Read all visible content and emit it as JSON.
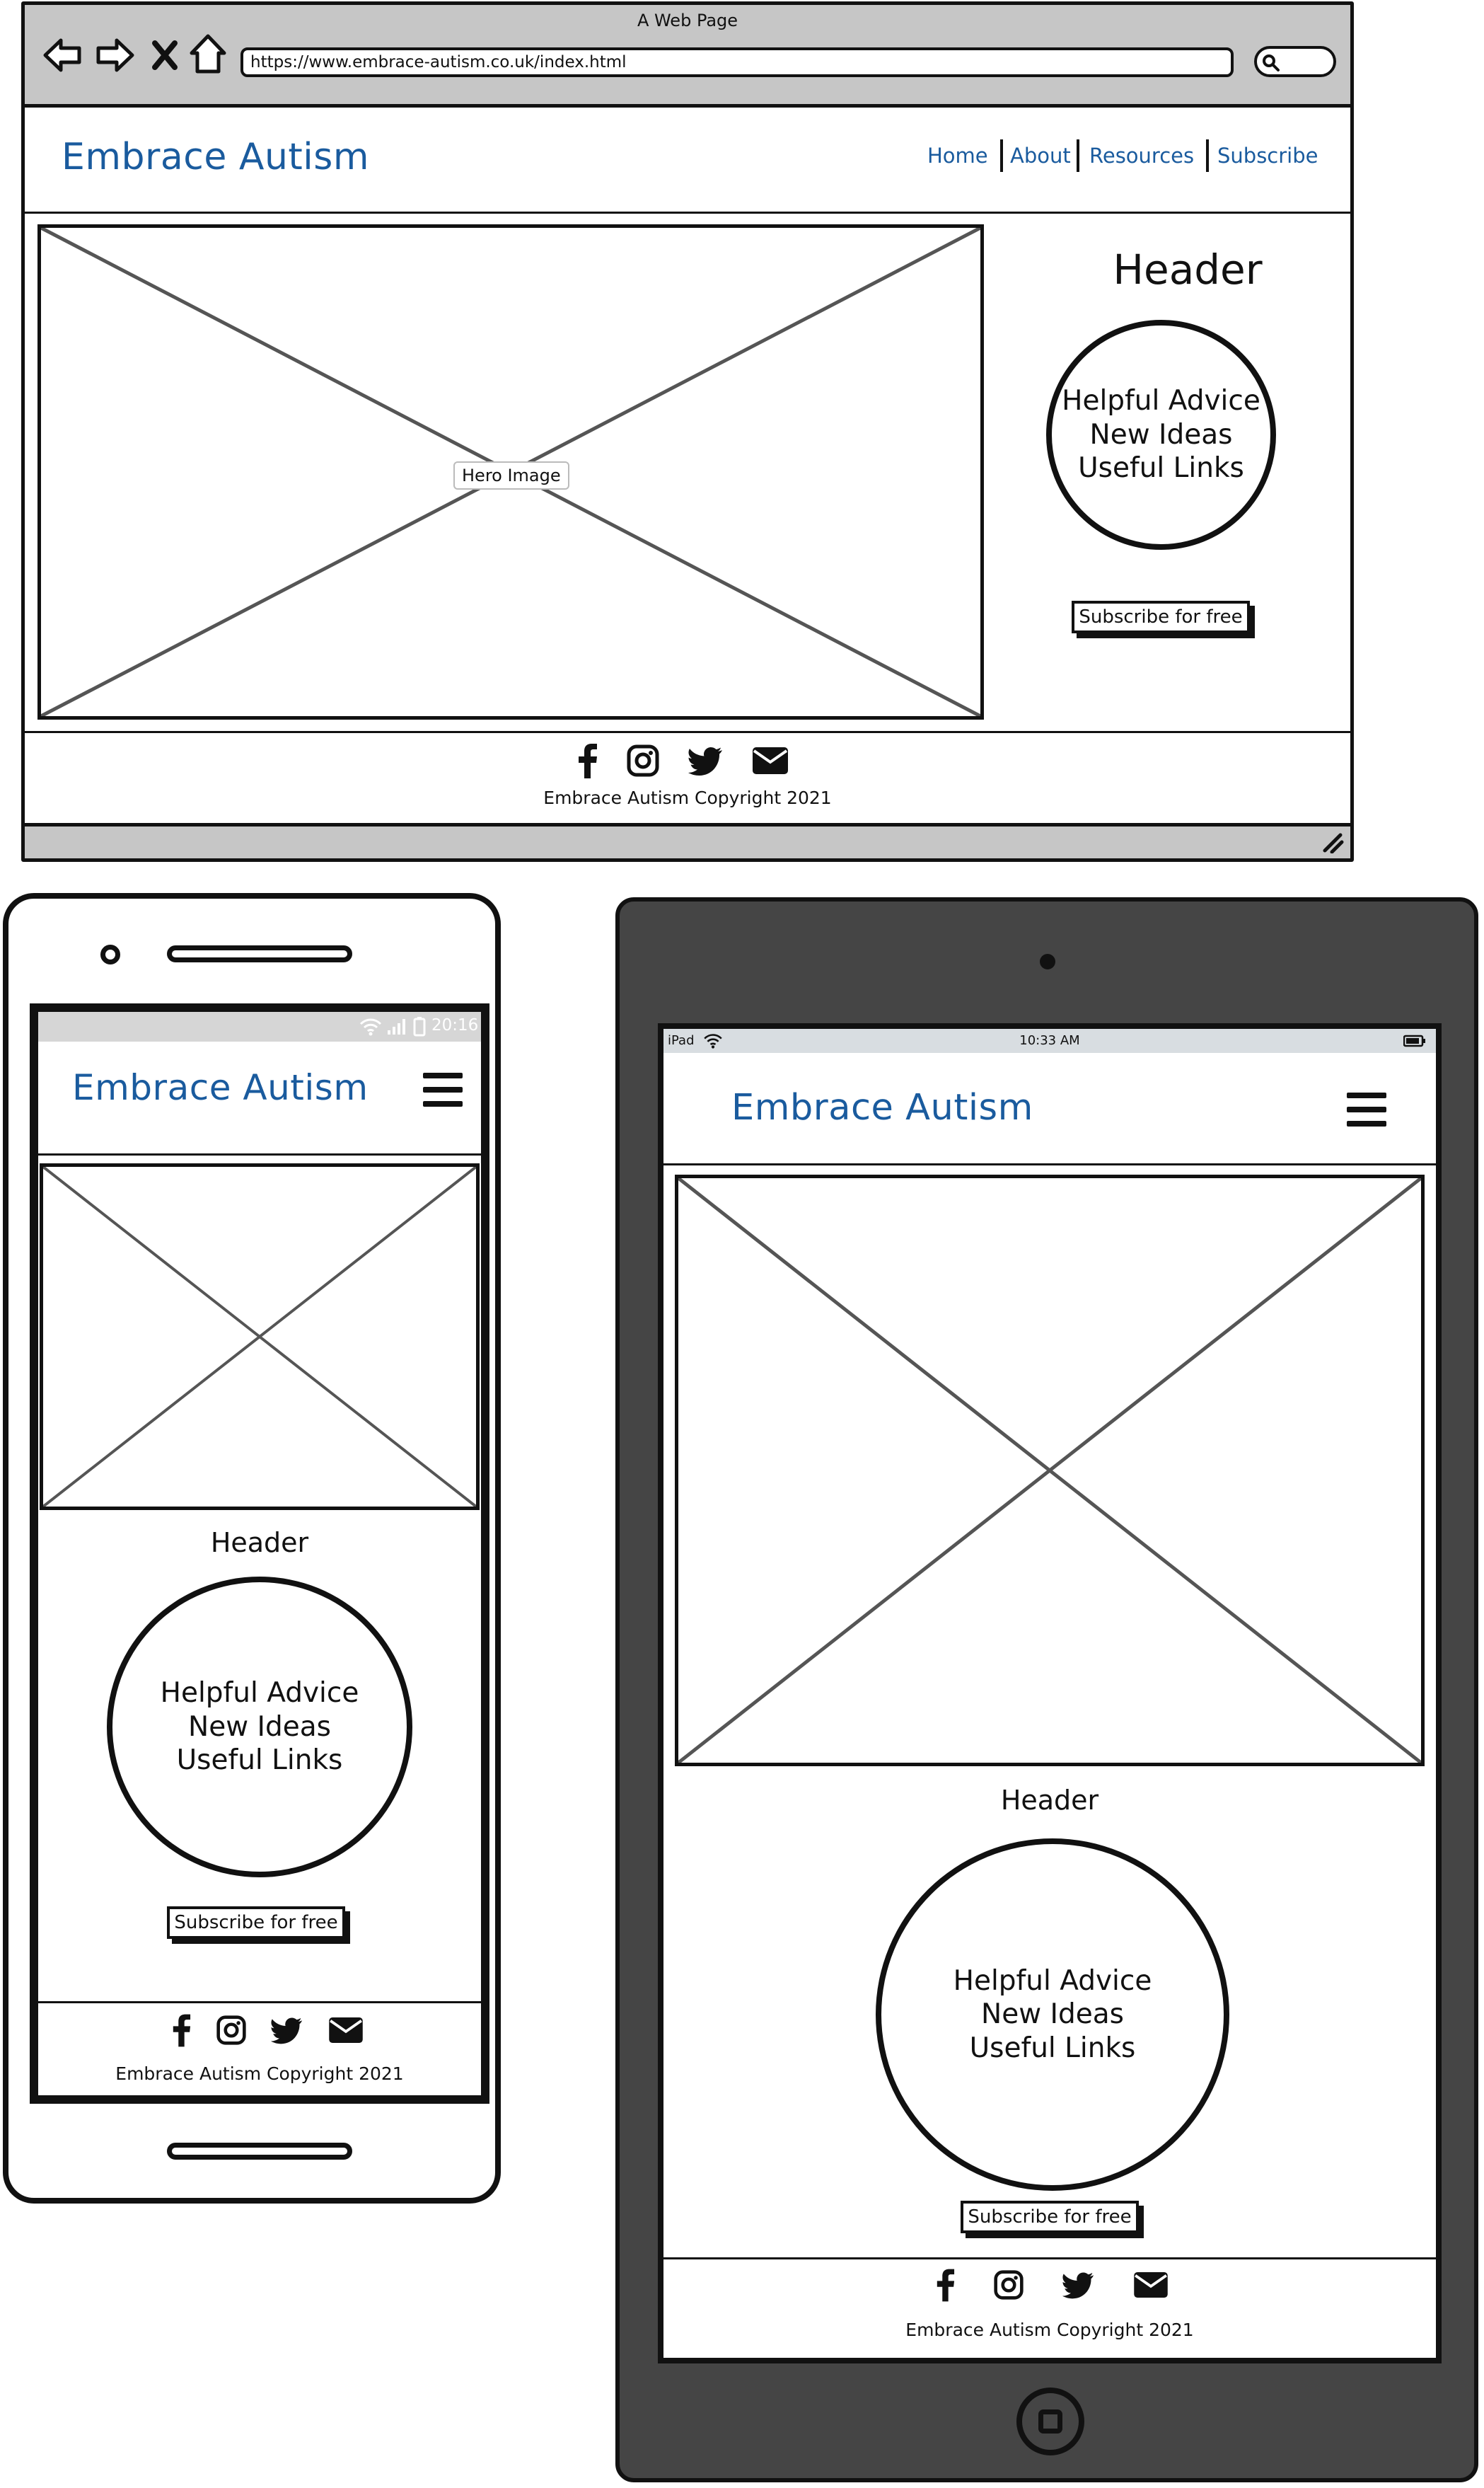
{
  "browser": {
    "window_title": "A Web Page",
    "url": "https://www.embrace-autism.co.uk/index.html",
    "site_title": "Embrace Autism",
    "nav": [
      "Home",
      "About",
      "Resources",
      "Subscribe"
    ],
    "hero_label": "Hero Image",
    "header": "Header",
    "circle_lines": [
      "Helpful Advice",
      "New Ideas",
      "Useful Links"
    ],
    "subscribe_label": "Subscribe for free",
    "copyright": "Embrace Autism Copyright 2021"
  },
  "phone": {
    "status_time": "20:16",
    "site_title": "Embrace Autism",
    "header": "Header",
    "circle_lines": [
      "Helpful Advice",
      "New Ideas",
      "Useful Links"
    ],
    "subscribe_label": "Subscribe for free",
    "copyright": "Embrace Autism Copyright 2021"
  },
  "tablet": {
    "status_device": "iPad",
    "status_time": "10:33 AM",
    "site_title": "Embrace Autism",
    "header": "Header",
    "circle_lines": [
      "Helpful Advice",
      "New Ideas",
      "Useful Links"
    ],
    "subscribe_label": "Subscribe for free",
    "copyright": "Embrace Autism Copyright 2021"
  },
  "icons": [
    "back-arrow-icon",
    "forward-arrow-icon",
    "close-icon",
    "home-icon",
    "search-icon",
    "facebook-icon",
    "instagram-icon",
    "twitter-icon",
    "email-icon",
    "hamburger-menu-icon",
    "wifi-icon",
    "signal-icon",
    "battery-icon",
    "camera-icon",
    "speaker-icon",
    "home-button-icon",
    "resize-grip-icon"
  ],
  "colors": {
    "brand_blue": "#1a5b9e",
    "chrome_grey": "#c6c6c6",
    "tablet_body": "#454545"
  }
}
